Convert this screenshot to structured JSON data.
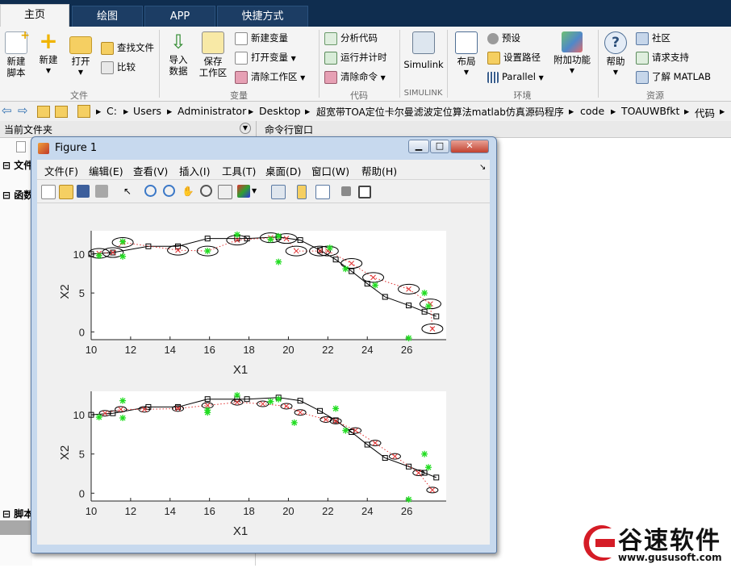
{
  "tabs": [
    {
      "label": "主页",
      "active": true
    },
    {
      "label": "绘图",
      "active": false
    },
    {
      "label": "APP",
      "active": false
    },
    {
      "label": "快捷方式",
      "active": false
    }
  ],
  "ribbon": {
    "file": {
      "new_script": [
        "新建",
        "脚本"
      ],
      "new": "新建",
      "open": "打开",
      "find_files": "查找文件",
      "compare": "比较",
      "group": "文件"
    },
    "variable": {
      "import": [
        "导入",
        "数据"
      ],
      "save": [
        "保存",
        "工作区"
      ],
      "new_var": "新建变量",
      "open_var": "打开变量",
      "clear_ws": "清除工作区",
      "group": "变量"
    },
    "code": {
      "analyze": "分析代码",
      "run_time": "运行并计时",
      "clear_cmd": "清除命令",
      "group": "代码"
    },
    "simulink": {
      "label": "Simulink",
      "group": "SIMULINK"
    },
    "env": {
      "layout": "布局",
      "prefs": "预设",
      "set_path": "设置路径",
      "parallel": "Parallel",
      "addons": "附加功能",
      "group": "环境"
    },
    "resources": {
      "help": "帮助",
      "community": "社区",
      "support": "请求支持",
      "learn": "了解 MATLAB",
      "group": "资源"
    }
  },
  "path": [
    "C:",
    "Users",
    "Administrator",
    "Desktop",
    "超宽带TOA定位卡尔曼滤波定位算法matlab仿真源码程序",
    "code",
    "TOAUWBfkt",
    "代码"
  ],
  "panels": {
    "current_folder": "当前文件夹",
    "command_window": "命令行窗口",
    "left_items": [
      "文件",
      "函数",
      "脚本"
    ]
  },
  "figure": {
    "title": "Figure 1",
    "menu": [
      "文件(F)",
      "编辑(E)",
      "查看(V)",
      "插入(I)",
      "工具(T)",
      "桌面(D)",
      "窗口(W)",
      "帮助(H)"
    ]
  },
  "logo": {
    "name": "谷速软件",
    "url": "www.gususoft.com"
  },
  "chart_data": [
    {
      "type": "line",
      "xlabel": "X1",
      "ylabel": "X2",
      "xlim": [
        10,
        28
      ],
      "ylim": [
        -1,
        13
      ],
      "xticks": [
        10,
        12,
        14,
        16,
        18,
        20,
        22,
        24,
        26
      ],
      "yticks": [
        0,
        5,
        10
      ],
      "series": [
        {
          "style": "black solid square",
          "x": [
            10,
            11.1,
            12.9,
            14.4,
            15.9,
            17.4,
            17.9,
            19.5,
            20.6,
            21.6,
            22.4,
            23.2,
            24,
            24.9,
            26.1,
            26.9,
            27.5
          ],
          "y": [
            10,
            10.2,
            11,
            11,
            12,
            12,
            12,
            12.2,
            11.8,
            10.5,
            9.3,
            7.8,
            6.2,
            4.5,
            3.4,
            2.6,
            2
          ]
        },
        {
          "style": "red dotted x with error ellipses",
          "x": [
            10.4,
            11.1,
            11.6,
            14.4,
            15.9,
            17.4,
            19.1,
            19.9,
            20.4,
            21.6,
            22,
            23.2,
            24.3,
            26.1,
            27.2,
            27.3
          ],
          "y": [
            10.1,
            10.2,
            11.5,
            10.5,
            10.4,
            11.8,
            12.1,
            12,
            10.4,
            10.4,
            10.4,
            8.8,
            7,
            5.5,
            3.6,
            0.4
          ]
        },
        {
          "style": "green star",
          "x": [
            10.4,
            11.6,
            11.6,
            15.9,
            17.4,
            19.1,
            19.5,
            19.5,
            22.1,
            22.9,
            24.4,
            26.1,
            26.9,
            27.1
          ],
          "y": [
            9.8,
            11.6,
            9.7,
            10.4,
            12.5,
            11.9,
            12.3,
            9,
            10.8,
            8.1,
            6,
            -0.8,
            5,
            3.3
          ]
        }
      ]
    },
    {
      "type": "line",
      "xlabel": "X1",
      "ylabel": "X2",
      "xlim": [
        10,
        28
      ],
      "ylim": [
        -1,
        13
      ],
      "xticks": [
        10,
        12,
        14,
        16,
        18,
        20,
        22,
        24,
        26
      ],
      "yticks": [
        0,
        5,
        10
      ],
      "series": [
        {
          "style": "black solid square",
          "x": [
            10,
            11.1,
            12.9,
            14.4,
            15.9,
            17.4,
            17.9,
            19.5,
            20.6,
            21.6,
            22.4,
            23.2,
            24,
            24.9,
            26.1,
            26.9,
            27.5
          ],
          "y": [
            10,
            10.2,
            11,
            11,
            12,
            12,
            12,
            12.2,
            11.8,
            10.5,
            9.3,
            7.8,
            6.2,
            4.5,
            3.4,
            2.6,
            2
          ]
        },
        {
          "style": "red dotted x with error ellipses",
          "x": [
            10.7,
            11.5,
            12.7,
            14.4,
            15.9,
            17.4,
            18.7,
            19.9,
            20.6,
            21.9,
            22.4,
            23.4,
            24.4,
            25.4,
            26.6,
            27.3
          ],
          "y": [
            10.2,
            10.7,
            10.7,
            10.8,
            11.2,
            11.6,
            11.4,
            11.1,
            10.3,
            9.4,
            9.2,
            8,
            6.4,
            4.7,
            2.6,
            0.4
          ]
        },
        {
          "style": "green star",
          "x": [
            10.4,
            11.6,
            11.6,
            15.9,
            15.9,
            17.4,
            19.1,
            19.5,
            20.3,
            22.4,
            22.9,
            26.1,
            26.9,
            27.1
          ],
          "y": [
            9.7,
            11.8,
            9.6,
            10.6,
            10.3,
            12.5,
            11.7,
            12,
            9,
            10.8,
            8,
            -0.8,
            5,
            3.3
          ]
        }
      ]
    }
  ]
}
